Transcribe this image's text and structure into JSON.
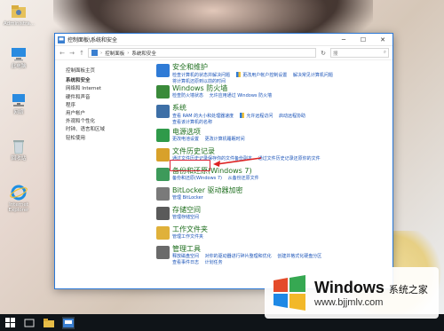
{
  "desktop": {
    "icons": [
      {
        "label": "Administra..."
      },
      {
        "label": "此电脑"
      },
      {
        "label": "网络"
      },
      {
        "label": "回收站"
      },
      {
        "label": "Internet Explorer"
      }
    ]
  },
  "window": {
    "title": "控制面板\\系统和安全",
    "address": {
      "crumbs": [
        "控制面板",
        "系统和安全"
      ]
    },
    "search_placeholder": "搜"
  },
  "sidebar": {
    "items": [
      {
        "label": "控制面板主页"
      },
      {
        "label": "系统和安全"
      },
      {
        "label": "网络和 Internet"
      },
      {
        "label": "硬件和声音"
      },
      {
        "label": "程序"
      },
      {
        "label": "用户帐户"
      },
      {
        "label": "外观和个性化"
      },
      {
        "label": "时钟、语言和区域"
      },
      {
        "label": "轻松使用"
      }
    ]
  },
  "categories": [
    {
      "title": "安全和维护",
      "links": [
        "检查计算机的状态并解决问题",
        "更改用户帐户控制设置",
        "解决常见计算机问题",
        "将计算机还原到以前的时间"
      ],
      "color": "#2f7bd6"
    },
    {
      "title": "Windows 防火墙",
      "links": [
        "检查防火墙状态",
        "允许应用通过 Windows 防火墙"
      ],
      "color": "#3a8a3a"
    },
    {
      "title": "系统",
      "links": [
        "查看 RAM 的大小和处理器速度",
        "允许远程访问",
        "启动远程协助",
        "查看该计算机的名称"
      ],
      "color": "#3d6fa6"
    },
    {
      "title": "电源选项",
      "links": [
        "更改电池设置",
        "更改计算机睡眠时间"
      ],
      "color": "#2f9a4a"
    },
    {
      "title": "文件历史记录",
      "links": [
        "通过文件历史记录保存你的文件备份副本",
        "通过文件历史记录还原你的文件"
      ],
      "color": "#d8a12a"
    },
    {
      "title": "备份和还原(Windows 7)",
      "links": [
        "备份和还原(Windows 7)",
        "从备份还原文件"
      ],
      "color": "#3d9a5a"
    },
    {
      "title": "BitLocker 驱动器加密",
      "links": [
        "管理 BitLocker"
      ],
      "color": "#7a7a7a"
    },
    {
      "title": "存储空间",
      "links": [
        "管理存储空间"
      ],
      "color": "#5a5a5a"
    },
    {
      "title": "工作文件夹",
      "links": [
        "管理工作文件夹"
      ],
      "color": "#e0b13a"
    },
    {
      "title": "管理工具",
      "links": [
        "释放磁盘空间",
        "对你的驱动器进行碎片整理和优化",
        "创建并格式化硬盘分区",
        "查看事件日志",
        "计划任务"
      ],
      "color": "#6a6a6a"
    }
  ],
  "watermark": {
    "brand": "Windows",
    "brand_cn": "系统之家",
    "url": "www.bjjmlv.com"
  }
}
